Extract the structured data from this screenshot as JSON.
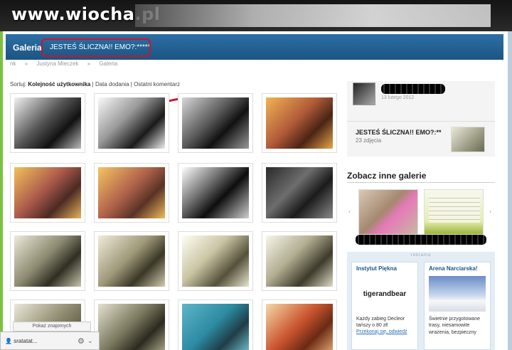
{
  "watermark": "www.wiocha.pl",
  "header": {
    "section": "Galeria",
    "title": "JESTEŚ ŚLICZNA!! EMO?:*****"
  },
  "breadcrumb": [
    "nk",
    "Justyna Mieczek",
    "Galeria"
  ],
  "sort": {
    "label": "Sortuj:",
    "options": [
      "Kolejność użytkownika",
      "Data dodania",
      "Ostatni komentarz"
    ],
    "separator": "|"
  },
  "profile": {
    "date_fragment": "13 lutego 2012"
  },
  "gallery_card": {
    "title": "JESTEŚ ŚLICZNA!! EMO?:**",
    "count": "23 zdjęcia"
  },
  "other_galleries": {
    "title": "Zobacz inne galerie",
    "prev": "‹",
    "next": "›"
  },
  "ads": {
    "label": "reklama",
    "items": [
      {
        "title": "Instytut Piękna",
        "logo": "tigerandbear",
        "text": "Każdy zabieg Decleor tańszy o 80 zł!",
        "link": "Przekonaj się, odwiedź"
      },
      {
        "title": "Arena Narciarska!",
        "text": "Świetnie przygotowane trasy, niesamowite wrażenia, bezpieczny"
      }
    ]
  },
  "footer": {
    "show_friends": "Pokaż znajomych",
    "user": "sratatat..."
  },
  "colors": {
    "header_blue": "#1b5582",
    "frame_green": "#7cc040",
    "highlight_red": "#d0122a"
  }
}
